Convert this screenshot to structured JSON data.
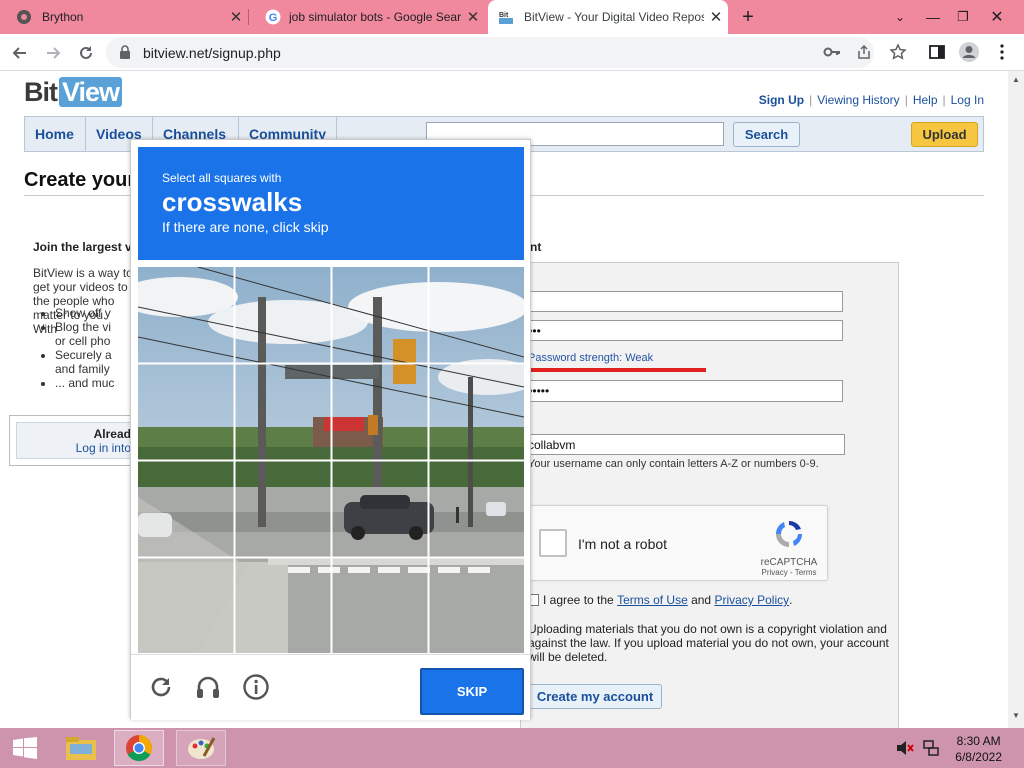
{
  "browser": {
    "tabs": [
      {
        "title": "Brython",
        "active": false
      },
      {
        "title": "job simulator bots - Google Search",
        "active": false
      },
      {
        "title": "BitView - Your Digital Video Repository",
        "active": true
      }
    ],
    "new_tab": "+",
    "url": "bitview.net/signup.php"
  },
  "site": {
    "logo_bit": "Bit",
    "logo_view": "View",
    "top_links": [
      "Sign Up",
      "Viewing History",
      "Help",
      "Log In"
    ],
    "nav_tabs": [
      "Home",
      "Videos",
      "Channels",
      "Community"
    ],
    "search_label": "Search",
    "upload_label": "Upload",
    "page_title": "Create your BitView Account",
    "join_heading": "Join the largest v",
    "intro": "BitView is a way to get your videos to the people who matter to you. With",
    "benefits": [
      "Show off y",
      "Blog the vi",
      "or cell pho",
      "Securely a",
      "and family",
      "... and muc"
    ],
    "login_a": "Alread",
    "login_b": "Log in into",
    "account_word": "nt",
    "password_mask": "••••",
    "strength_text": "Password strength: Weak",
    "confirm_mask": "••••••",
    "username_value": "collabvm",
    "username_hint": "Your username can only contain letters A-Z or numbers 0-9.",
    "recaptcha_label": "I'm not a robot",
    "recaptcha_brand": "reCAPTCHA",
    "recaptcha_terms": "Privacy - Terms",
    "agree_prefix": "I agree to the ",
    "agree_tos": "Terms of Use",
    "agree_and": " and ",
    "agree_privacy": "Privacy Policy",
    "agree_end": ".",
    "warning": "Uploading materials that you do not own is a copyright violation and against the law. If you upload material you do not own, your account will be deleted.",
    "create_label": "Create my account"
  },
  "captcha": {
    "instruction": "Select all squares with",
    "target": "crosswalks",
    "hint": "If there are none, click skip",
    "skip_label": "SKIP",
    "reload_icon": "reload-icon",
    "audio_icon": "headphones-icon",
    "info_icon": "info-icon"
  },
  "taskbar": {
    "time": "8:30 AM",
    "date": "6/8/2022"
  },
  "colors": {
    "tabstrip": "#f0889e",
    "captcha_blue": "#1a73e8",
    "strength_red": "#e2201f",
    "link_blue": "#1a4f9c",
    "taskbar": "#cf94ad"
  }
}
